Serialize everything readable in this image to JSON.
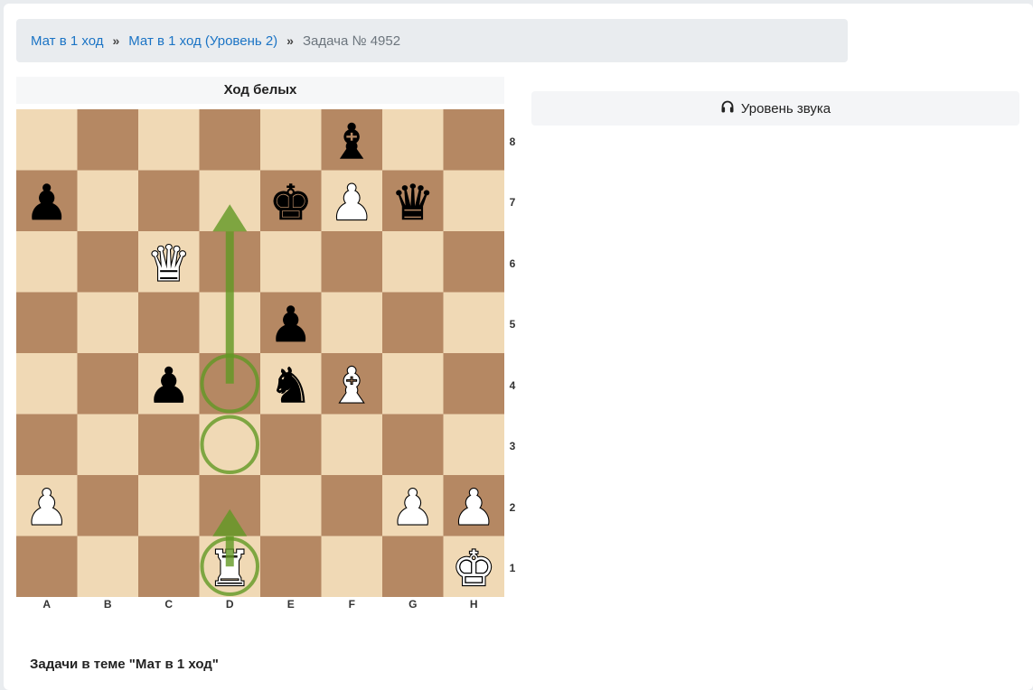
{
  "breadcrumb": {
    "items": [
      "Мат в 1 ход",
      "Мат в 1 ход (Уровень 2)"
    ],
    "separator": "»",
    "current": "Задача № 4952"
  },
  "turn_label": "Ход белых",
  "sound_button": {
    "label": "Уровень звука",
    "icon": "headphones-icon"
  },
  "board": {
    "light_color": "#f0d9b5",
    "dark_color": "#b58863",
    "arrow_color": "#629924",
    "files": [
      "A",
      "B",
      "C",
      "D",
      "E",
      "F",
      "G",
      "H"
    ],
    "ranks": [
      "8",
      "7",
      "6",
      "5",
      "4",
      "3",
      "2",
      "1"
    ],
    "pieces": [
      {
        "square": "f8",
        "color": "black",
        "type": "bishop"
      },
      {
        "square": "a7",
        "color": "black",
        "type": "pawn"
      },
      {
        "square": "e7",
        "color": "black",
        "type": "king"
      },
      {
        "square": "f7",
        "color": "white",
        "type": "pawn"
      },
      {
        "square": "g7",
        "color": "black",
        "type": "queen"
      },
      {
        "square": "c6",
        "color": "white",
        "type": "queen"
      },
      {
        "square": "e5",
        "color": "black",
        "type": "pawn"
      },
      {
        "square": "c4",
        "color": "black",
        "type": "pawn"
      },
      {
        "square": "e4",
        "color": "black",
        "type": "knight"
      },
      {
        "square": "f4",
        "color": "white",
        "type": "bishop"
      },
      {
        "square": "a2",
        "color": "white",
        "type": "pawn"
      },
      {
        "square": "g2",
        "color": "white",
        "type": "pawn"
      },
      {
        "square": "h2",
        "color": "white",
        "type": "pawn"
      },
      {
        "square": "d1",
        "color": "white",
        "type": "rook"
      },
      {
        "square": "h1",
        "color": "white",
        "type": "king"
      }
    ],
    "circles": [
      "d4",
      "d3",
      "d1"
    ],
    "arrows": [
      {
        "from": "d4",
        "to": "d7"
      },
      {
        "from": "d1",
        "to": "d2"
      }
    ]
  },
  "topic_heading": "Задачи в теме \"Мат в 1 ход\""
}
